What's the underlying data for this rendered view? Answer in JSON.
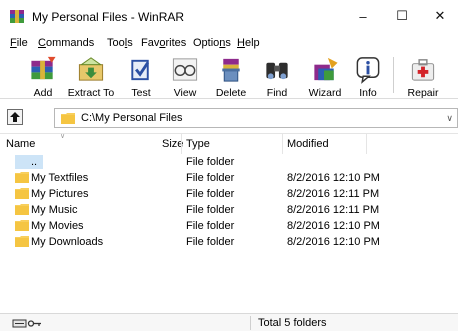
{
  "window": {
    "title": "My Personal Files - WinRAR",
    "minimize_glyph": "–",
    "maximize_glyph": "☐",
    "close_glyph": "✕"
  },
  "menu": [
    {
      "label": "File",
      "accel": "F",
      "rest": "ile"
    },
    {
      "label": "Commands",
      "accel": "C",
      "rest": "ommands"
    },
    {
      "label": "Tools",
      "pre": "Too",
      "accel": "l",
      "rest": "s"
    },
    {
      "label": "Favorites",
      "pre": "Fav",
      "accel": "o",
      "rest": "rites"
    },
    {
      "label": "Options",
      "pre": "Optio",
      "accel": "n",
      "rest": "s"
    },
    {
      "label": "Help",
      "accel": "H",
      "rest": "elp"
    }
  ],
  "toolbar": {
    "add": "Add",
    "extract": "Extract To",
    "test": "Test",
    "view": "View",
    "delete": "Delete",
    "find": "Find",
    "wizard": "Wizard",
    "info": "Info",
    "repair": "Repair"
  },
  "address": {
    "path": "C:\\My Personal Files"
  },
  "columns": {
    "name": "Name",
    "size": "Size",
    "type": "Type",
    "modified": "Modified"
  },
  "rows": [
    {
      "name": "..",
      "type": "File folder",
      "modified": ""
    },
    {
      "name": "My Textfiles",
      "type": "File folder",
      "modified": "8/2/2016 12:10 PM"
    },
    {
      "name": "My Pictures",
      "type": "File folder",
      "modified": "8/2/2016 12:11 PM"
    },
    {
      "name": "My Music",
      "type": "File folder",
      "modified": "8/2/2016 12:11 PM"
    },
    {
      "name": "My Movies",
      "type": "File folder",
      "modified": "8/2/2016 12:10 PM"
    },
    {
      "name": "My Downloads",
      "type": "File folder",
      "modified": "8/2/2016 12:10 PM"
    }
  ],
  "status": {
    "total": "Total 5 folders"
  },
  "colors": {
    "folder": "#f8cf5c",
    "selection": "#cde4f7"
  }
}
